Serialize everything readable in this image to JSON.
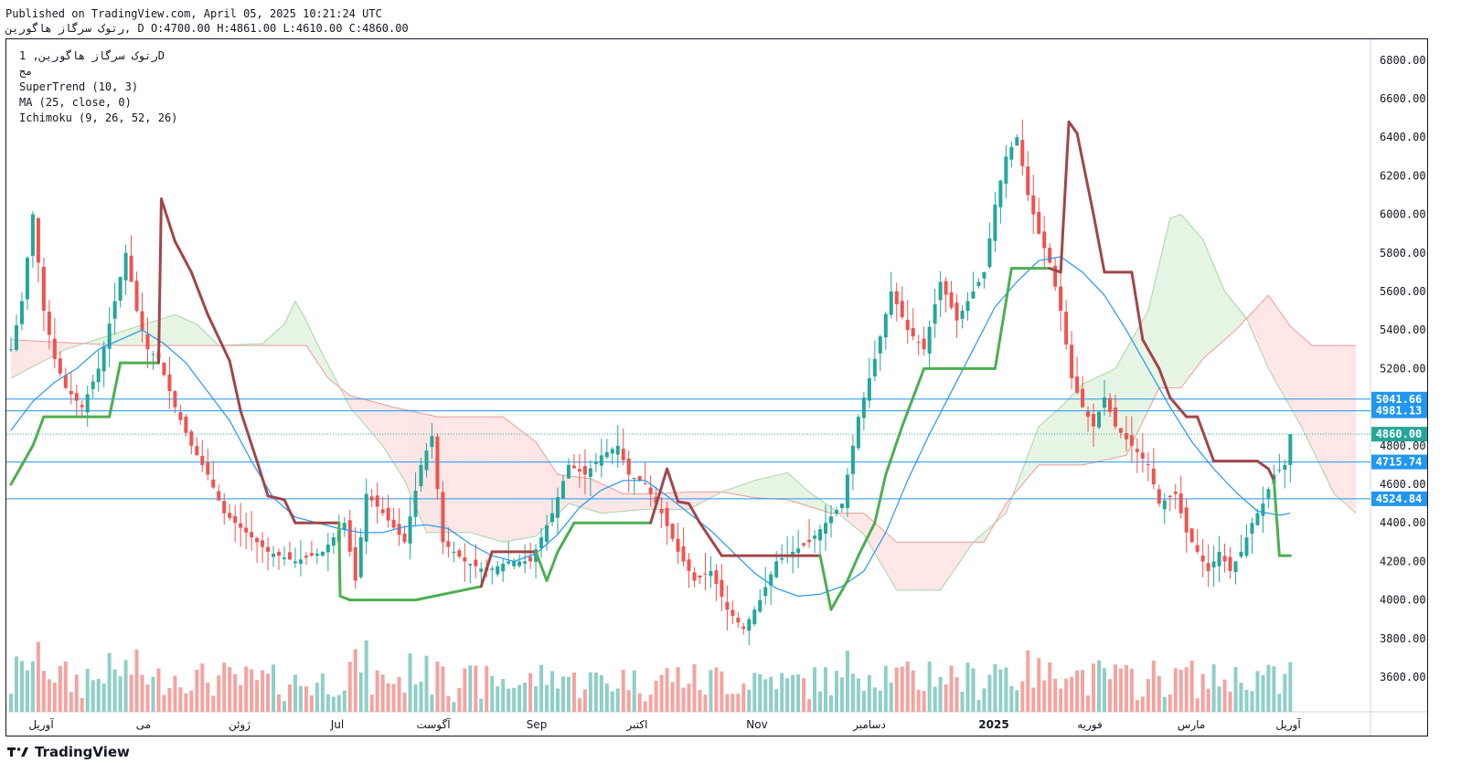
{
  "header": {
    "published": "Published on TradingView.com, April 05, 2025 10:21:24 UTC",
    "ohlc": "رتوک سرگاز هاگورین, D O:4700.00 H:4861.00 L:4610.00 C:4860.00"
  },
  "legend": {
    "symbol": "رتوک سرگاز هاگورین, 1D",
    "note": "مج",
    "supertrend": "SuperTrend (10, 3)",
    "ma": "MA (25, close, 0)",
    "ichimoku": "Ichimoku (9, 26, 52, 26)"
  },
  "logo": {
    "text": "TradingView"
  },
  "colors": {
    "up": "#26a69a",
    "down": "#ef5350",
    "supertrend_up": "#4caf50",
    "supertrend_down": "#a0464b",
    "ma": "#2196f3",
    "hline": "#2196f3",
    "cloud_bull": "#e6f4e3",
    "cloud_bear": "#fde6e6",
    "last_price": "#26a69a"
  },
  "chart_data": {
    "type": "candlestick",
    "y_ticks": [
      3600,
      3800,
      4000,
      4200,
      4400,
      4600,
      4800,
      5000,
      5200,
      5400,
      5600,
      5800,
      6000,
      6200,
      6400,
      6600,
      6800
    ],
    "y_tick_labels": [
      "3600.00",
      "3800.00",
      "4000.00",
      "4200.00",
      "4400.00",
      "4600.00",
      "4800.00",
      "5000.00",
      "5200.00",
      "5400.00",
      "5600.00",
      "5800.00",
      "6000.00",
      "6200.00",
      "6400.00",
      "6600.00",
      "6800.00"
    ],
    "ylim": [
      3420,
      6960
    ],
    "x_labels": [
      {
        "text": "آوریل",
        "month": 0
      },
      {
        "text": "می",
        "month": 1
      },
      {
        "text": "ژوئن",
        "month": 2
      },
      {
        "text": "Jul",
        "month": 3
      },
      {
        "text": "آگوست",
        "month": 4
      },
      {
        "text": "Sep",
        "month": 5
      },
      {
        "text": "اکتبر",
        "month": 6
      },
      {
        "text": "Nov",
        "month": 7
      },
      {
        "text": "دسامبر",
        "month": 8
      },
      {
        "text": "2025",
        "month": 9
      },
      {
        "text": "فوریه",
        "month": 10
      },
      {
        "text": "مارس",
        "month": 11
      },
      {
        "text": "آوریل",
        "month": 12
      }
    ],
    "horizontal_lines": [
      5041.66,
      4981.13,
      4715.74,
      4524.84
    ],
    "horizontal_line_labels": [
      "5041.66",
      "4981.13",
      "4715.74",
      "4524.84"
    ],
    "last_price": 4860,
    "last_price_label": "4860.00",
    "ohlc": {
      "open": 4700,
      "high": 4861,
      "low": 4610,
      "close": 4860
    },
    "price_path": [
      [
        0,
        5300
      ],
      [
        2,
        5550
      ],
      [
        4,
        6000
      ],
      [
        6,
        5500
      ],
      [
        8,
        5250
      ],
      [
        10,
        5100
      ],
      [
        13,
        5000
      ],
      [
        16,
        5200
      ],
      [
        19,
        5550
      ],
      [
        21,
        5800
      ],
      [
        23,
        5500
      ],
      [
        25,
        5300
      ],
      [
        27,
        5250
      ],
      [
        30,
        5000
      ],
      [
        33,
        4800
      ],
      [
        36,
        4650
      ],
      [
        39,
        4450
      ],
      [
        43,
        4350
      ],
      [
        47,
        4250
      ],
      [
        52,
        4200
      ],
      [
        57,
        4250
      ],
      [
        61,
        4400
      ],
      [
        63,
        4100
      ],
      [
        65,
        4550
      ],
      [
        68,
        4450
      ],
      [
        72,
        4300
      ],
      [
        75,
        4700
      ],
      [
        77,
        4850
      ],
      [
        79,
        4300
      ],
      [
        83,
        4200
      ],
      [
        87,
        4150
      ],
      [
        91,
        4200
      ],
      [
        95,
        4200
      ],
      [
        99,
        4450
      ],
      [
        102,
        4700
      ],
      [
        105,
        4650
      ],
      [
        108,
        4750
      ],
      [
        111,
        4800
      ],
      [
        113,
        4650
      ],
      [
        116,
        4600
      ],
      [
        119,
        4450
      ],
      [
        122,
        4250
      ],
      [
        125,
        4100
      ],
      [
        128,
        4150
      ],
      [
        131,
        3950
      ],
      [
        134,
        3850
      ],
      [
        137,
        4000
      ],
      [
        140,
        4200
      ],
      [
        143,
        4250
      ],
      [
        146,
        4300
      ],
      [
        149,
        4400
      ],
      [
        152,
        4500
      ],
      [
        155,
        4950
      ],
      [
        158,
        5250
      ],
      [
        161,
        5600
      ],
      [
        164,
        5400
      ],
      [
        167,
        5300
      ],
      [
        170,
        5650
      ],
      [
        173,
        5450
      ],
      [
        176,
        5600
      ],
      [
        178,
        5700
      ],
      [
        180,
        6050
      ],
      [
        182,
        6300
      ],
      [
        184,
        6400
      ],
      [
        186,
        6100
      ],
      [
        188,
        5900
      ],
      [
        190,
        5750
      ],
      [
        192,
        5500
      ],
      [
        194,
        5150
      ],
      [
        196,
        5000
      ],
      [
        198,
        4900
      ],
      [
        200,
        5050
      ],
      [
        202,
        4900
      ],
      [
        205,
        4800
      ],
      [
        208,
        4700
      ],
      [
        210,
        4500
      ],
      [
        213,
        4550
      ],
      [
        215,
        4350
      ],
      [
        217,
        4250
      ],
      [
        219,
        4150
      ],
      [
        221,
        4250
      ],
      [
        223,
        4150
      ],
      [
        225,
        4250
      ],
      [
        227,
        4400
      ],
      [
        229,
        4500
      ],
      [
        231,
        4650
      ],
      [
        233,
        4700
      ],
      [
        234,
        4860
      ]
    ],
    "supertrend": [
      [
        0,
        4600
      ],
      [
        2,
        4700
      ],
      [
        4,
        4800
      ],
      [
        6,
        4950
      ],
      [
        9,
        4950
      ],
      [
        18,
        4950
      ],
      [
        20,
        5230
      ],
      [
        27,
        5230
      ],
      [
        27.5,
        6080
      ],
      [
        30,
        5860
      ],
      [
        33,
        5700
      ],
      [
        36,
        5480
      ],
      [
        40,
        5240
      ],
      [
        42,
        4980
      ],
      [
        45,
        4720
      ],
      [
        47,
        4540
      ],
      [
        50,
        4520
      ],
      [
        52,
        4400
      ],
      [
        60,
        4400
      ],
      [
        60.2,
        4020
      ],
      [
        62,
        4000
      ],
      [
        74,
        4000
      ],
      [
        86,
        4070
      ],
      [
        88,
        4250
      ],
      [
        96,
        4250
      ],
      [
        98,
        4100
      ],
      [
        100,
        4250
      ],
      [
        103,
        4400
      ],
      [
        117,
        4400
      ],
      [
        120,
        4680
      ],
      [
        122,
        4510
      ],
      [
        124,
        4500
      ],
      [
        126,
        4400
      ],
      [
        130,
        4230
      ],
      [
        148,
        4230
      ],
      [
        150,
        3950
      ],
      [
        153,
        4100
      ],
      [
        155,
        4230
      ],
      [
        158,
        4400
      ],
      [
        160,
        4650
      ],
      [
        163,
        4900
      ],
      [
        167,
        5200
      ],
      [
        180,
        5200
      ],
      [
        183,
        5720
      ],
      [
        190,
        5720
      ],
      [
        192,
        5700
      ],
      [
        193.5,
        6480
      ],
      [
        195,
        6420
      ],
      [
        198,
        6000
      ],
      [
        200,
        5700
      ],
      [
        205,
        5700
      ],
      [
        207,
        5350
      ],
      [
        210,
        5200
      ],
      [
        212,
        5050
      ],
      [
        215,
        4950
      ],
      [
        217,
        4950
      ],
      [
        220,
        4720
      ],
      [
        228,
        4720
      ],
      [
        230,
        4680
      ],
      [
        231,
        4620
      ],
      [
        232,
        4230
      ],
      [
        234,
        4230
      ]
    ],
    "ma": [
      [
        0,
        4880
      ],
      [
        4,
        5030
      ],
      [
        8,
        5130
      ],
      [
        12,
        5200
      ],
      [
        16,
        5300
      ],
      [
        20,
        5350
      ],
      [
        24,
        5400
      ],
      [
        28,
        5330
      ],
      [
        32,
        5230
      ],
      [
        36,
        5080
      ],
      [
        40,
        4930
      ],
      [
        44,
        4720
      ],
      [
        48,
        4530
      ],
      [
        52,
        4430
      ],
      [
        56,
        4400
      ],
      [
        60,
        4370
      ],
      [
        64,
        4350
      ],
      [
        68,
        4350
      ],
      [
        72,
        4380
      ],
      [
        76,
        4390
      ],
      [
        80,
        4370
      ],
      [
        84,
        4290
      ],
      [
        88,
        4230
      ],
      [
        92,
        4200
      ],
      [
        96,
        4240
      ],
      [
        100,
        4340
      ],
      [
        104,
        4480
      ],
      [
        108,
        4570
      ],
      [
        112,
        4620
      ],
      [
        116,
        4620
      ],
      [
        120,
        4540
      ],
      [
        124,
        4450
      ],
      [
        128,
        4360
      ],
      [
        132,
        4250
      ],
      [
        136,
        4140
      ],
      [
        140,
        4060
      ],
      [
        144,
        4020
      ],
      [
        148,
        4030
      ],
      [
        152,
        4070
      ],
      [
        156,
        4150
      ],
      [
        160,
        4350
      ],
      [
        164,
        4620
      ],
      [
        168,
        4860
      ],
      [
        172,
        5080
      ],
      [
        176,
        5300
      ],
      [
        180,
        5520
      ],
      [
        184,
        5650
      ],
      [
        188,
        5760
      ],
      [
        192,
        5780
      ],
      [
        196,
        5700
      ],
      [
        200,
        5580
      ],
      [
        204,
        5400
      ],
      [
        208,
        5200
      ],
      [
        212,
        5000
      ],
      [
        216,
        4820
      ],
      [
        220,
        4680
      ],
      [
        224,
        4560
      ],
      [
        228,
        4460
      ],
      [
        232,
        4440
      ],
      [
        234,
        4450
      ]
    ],
    "cloud_span_a": [
      [
        0,
        5150
      ],
      [
        10,
        5300
      ],
      [
        20,
        5390
      ],
      [
        30,
        5480
      ],
      [
        34,
        5430
      ],
      [
        38,
        5320
      ],
      [
        46,
        5330
      ],
      [
        50,
        5430
      ],
      [
        52,
        5550
      ],
      [
        54,
        5450
      ],
      [
        56,
        5330
      ],
      [
        62,
        5000
      ],
      [
        68,
        4800
      ],
      [
        72,
        4620
      ],
      [
        76,
        4350
      ],
      [
        84,
        4350
      ],
      [
        90,
        4300
      ],
      [
        96,
        4330
      ],
      [
        102,
        4500
      ],
      [
        108,
        4450
      ],
      [
        116,
        4470
      ],
      [
        124,
        4470
      ],
      [
        130,
        4560
      ],
      [
        136,
        4620
      ],
      [
        142,
        4660
      ],
      [
        146,
        4560
      ],
      [
        150,
        4480
      ],
      [
        156,
        4340
      ],
      [
        162,
        4050
      ],
      [
        170,
        4050
      ],
      [
        176,
        4300
      ],
      [
        182,
        4450
      ],
      [
        188,
        4900
      ],
      [
        192,
        5000
      ],
      [
        196,
        5120
      ],
      [
        202,
        5200
      ],
      [
        208,
        5500
      ],
      [
        212,
        5980
      ],
      [
        214,
        6000
      ],
      [
        218,
        5870
      ],
      [
        222,
        5600
      ],
      [
        226,
        5460
      ],
      [
        230,
        5200
      ],
      [
        236,
        4900
      ],
      [
        242,
        4550
      ],
      [
        246,
        4450
      ]
    ],
    "cloud_span_b": [
      [
        0,
        5350
      ],
      [
        20,
        5320
      ],
      [
        40,
        5320
      ],
      [
        54,
        5320
      ],
      [
        58,
        5150
      ],
      [
        62,
        5060
      ],
      [
        70,
        5000
      ],
      [
        78,
        4950
      ],
      [
        90,
        4950
      ],
      [
        96,
        4820
      ],
      [
        100,
        4650
      ],
      [
        106,
        4630
      ],
      [
        112,
        4550
      ],
      [
        118,
        4550
      ],
      [
        124,
        4560
      ],
      [
        130,
        4560
      ],
      [
        136,
        4530
      ],
      [
        142,
        4520
      ],
      [
        150,
        4450
      ],
      [
        156,
        4450
      ],
      [
        162,
        4300
      ],
      [
        170,
        4300
      ],
      [
        178,
        4300
      ],
      [
        182,
        4500
      ],
      [
        188,
        4700
      ],
      [
        196,
        4700
      ],
      [
        204,
        4750
      ],
      [
        210,
        5100
      ],
      [
        214,
        5100
      ],
      [
        218,
        5250
      ],
      [
        224,
        5400
      ],
      [
        230,
        5580
      ],
      [
        234,
        5420
      ],
      [
        238,
        5320
      ],
      [
        246,
        5320
      ]
    ]
  }
}
